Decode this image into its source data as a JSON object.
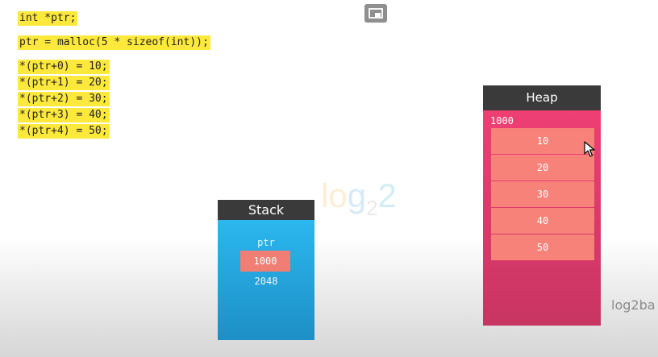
{
  "code_lines": [
    "int *ptr;",
    "ptr = malloc(5 * sizeof(int));",
    "*(ptr+0) = 10;",
    "*(ptr+1) = 20;",
    "*(ptr+2) = 30;",
    "*(ptr+3) = 40;",
    "*(ptr+4) = 50;"
  ],
  "watermark": {
    "part1": "lo",
    "part2": "g",
    "sub": "2",
    "part3": "2"
  },
  "stack": {
    "title": "Stack",
    "variable": "ptr",
    "value": "1000",
    "address": "2048"
  },
  "heap": {
    "title": "Heap",
    "base_address": "1000",
    "cells": [
      "10",
      "20",
      "30",
      "40",
      "50"
    ]
  },
  "brand_text": "log2ba",
  "icons": {
    "pip": "picture-in-picture-icon",
    "cursor": "mouse-pointer-icon"
  },
  "colors": {
    "code_highlight": "#fde93c",
    "stack": "#2bb7ef",
    "heap": "#ee3f73",
    "cell": "#f7827a",
    "header": "#3a3a3a"
  }
}
